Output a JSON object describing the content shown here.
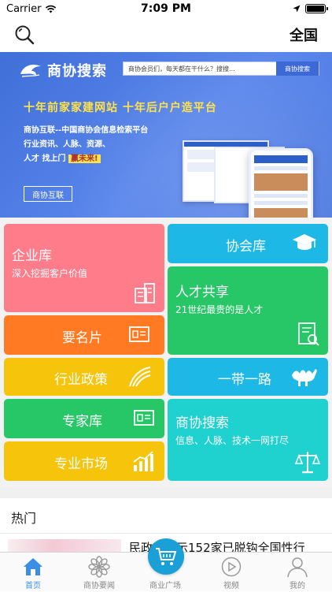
{
  "status_bar": {
    "carrier": "Carrier",
    "time": "7:09 PM",
    "battery_level": 1.0
  },
  "nav": {
    "region": "全国"
  },
  "banner": {
    "logo_text": "商协搜索",
    "search_placeholder": "商协会员们，每天都在干什么？搜搜...",
    "search_button": "商协搜索",
    "slogan": "十年前家家建网站 十年后户户造平台",
    "desc1": "商协互联--中国商协会信息检索平台",
    "desc2": "行业资讯、人脉、资源、",
    "desc3_prefix": "人才 找上门",
    "desc3_badge": "赢未来!",
    "button": "商协互联",
    "slides_count": 4,
    "active_slide": 1
  },
  "tiles": {
    "enterprise": {
      "title": "企业库",
      "subtitle": "深入挖掘客户价值",
      "color": "#ff7c8a"
    },
    "association": {
      "title": "协会库",
      "color": "#1eb8e6"
    },
    "talent": {
      "title": "人才共享",
      "subtitle": "21世纪最贵的是人才",
      "color": "#27c768"
    },
    "card": {
      "title": "要名片",
      "color": "#ff7a22"
    },
    "policy": {
      "title": "行业政策",
      "color": "#f5c40b"
    },
    "belt_road": {
      "title": "一带一路",
      "color": "#1eb8e6"
    },
    "experts": {
      "title": "专家库",
      "color": "#27c768"
    },
    "market": {
      "title": "专业市场",
      "color": "#f5c40b"
    },
    "search": {
      "title": "商协搜索",
      "subtitle": "信息、人脉、技术一网打尽",
      "color": "#1fd2cf"
    }
  },
  "hot": {
    "title": "热门",
    "news": [
      {
        "title": "民政部公示152家已脱钩全国性行"
      }
    ]
  },
  "tabbar": {
    "items": [
      {
        "label": "首页"
      },
      {
        "label": "商协要闻"
      },
      {
        "label": "商业广场"
      },
      {
        "label": "视频"
      },
      {
        "label": "我的"
      }
    ],
    "active_color": "#3a8ee6",
    "inactive_color": "#888888"
  }
}
